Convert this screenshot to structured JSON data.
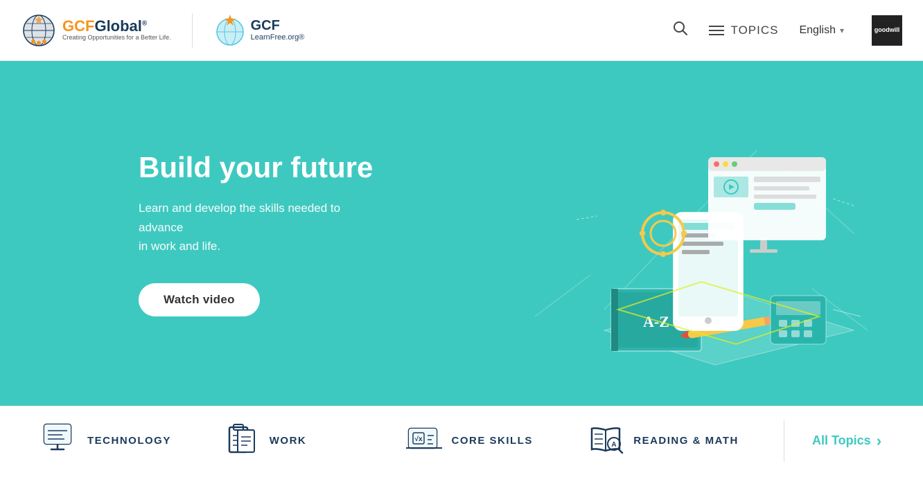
{
  "header": {
    "gcfglobal_logo_text": "GCFGlobal",
    "gcfglobal_logo_highlight": "GCF",
    "gcfglobal_tagline": "Creating Opportunities for a Better Life.",
    "learnfree_text": "GCF\nLearnFree.org®",
    "topics_label": "TOPICS",
    "language_label": "English",
    "goodwill_label": "goodwill"
  },
  "hero": {
    "title": "Build your future",
    "subtitle": "Learn and develop the skills needed to advance\nin work and life.",
    "cta_label": "Watch video"
  },
  "bottom_nav": {
    "items": [
      {
        "id": "technology",
        "label": "TECHNOLOGY"
      },
      {
        "id": "work",
        "label": "WORK"
      },
      {
        "id": "core-skills",
        "label": "CORE SKILLS"
      },
      {
        "id": "reading-math",
        "label": "READING & MATH"
      }
    ],
    "all_topics_label": "All Topics"
  }
}
